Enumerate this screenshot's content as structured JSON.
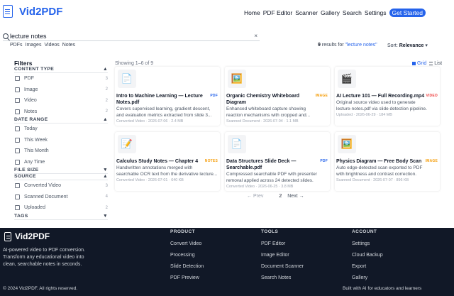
{
  "header": {
    "brand": "Vid2PDF",
    "nav": [
      "Home",
      "PDF Editor",
      "Scanner",
      "Gallery",
      "Search",
      "Settings"
    ],
    "cta": "Get Started",
    "colors": {
      "accent": "#2563eb"
    }
  },
  "search": {
    "value": "lecture notes",
    "clear_symbol": "×",
    "tabs": [
      "PDFs",
      "Images",
      "Videos",
      "Notes"
    ],
    "results_count": "9",
    "results_text": "results for",
    "query_display": "\"lecture notes\"",
    "sort_label": "Sort:",
    "sort_value": "Relevance",
    "sort_caret": "▾"
  },
  "sidebar": {
    "title": "Filters",
    "sections": [
      {
        "name": "CONTENT TYPE",
        "caret": "▲",
        "options": [
          {
            "label": "PDF",
            "count": "3"
          },
          {
            "label": "Image",
            "count": "2"
          },
          {
            "label": "Video",
            "count": "2"
          },
          {
            "label": "Notes",
            "count": "2"
          }
        ]
      },
      {
        "name": "DATE RANGE",
        "caret": "▲",
        "options": [
          {
            "label": "Today"
          },
          {
            "label": "This Week"
          },
          {
            "label": "This Month"
          },
          {
            "label": "Any Time"
          }
        ]
      },
      {
        "name": "FILE SIZE",
        "caret": "▼",
        "options": []
      },
      {
        "name": "SOURCE",
        "caret": "▲",
        "options": [
          {
            "label": "Converted Video",
            "count": "3"
          },
          {
            "label": "Scanned Document",
            "count": "4"
          },
          {
            "label": "Uploaded",
            "count": "2"
          }
        ]
      },
      {
        "name": "TAGS",
        "caret": "▼",
        "options": []
      }
    ]
  },
  "main": {
    "showing": "Showing 1–6 of 9",
    "view_grid": "Grid",
    "view_list": "List",
    "cards": [
      {
        "icon": "📄",
        "icon_name": "document-icon",
        "badge": "PDF",
        "badge_color": "#2563eb",
        "title_lines": [
          "Intro to Machine Learning — Lecture",
          "Notes.pdf"
        ],
        "desc_lines": [
          "Covers supervised learning, gradient descent,",
          "and evaluation metrics extracted from slide 3..."
        ],
        "meta": "Converted Video  ·  2026-07-06  ·  2.4 MB"
      },
      {
        "icon": "🖼️",
        "icon_name": "image-icon",
        "badge": "IMAGE",
        "badge_color": "#f59e0b",
        "title_lines": [
          "Organic Chemistry Whiteboard",
          "Diagram"
        ],
        "desc_lines": [
          "Enhanced whiteboard capture showing",
          "reaction mechanisms with cropped and..."
        ],
        "meta": "Scanned Document  ·  2026-07-04  ·  1.1 MB"
      },
      {
        "icon": "🎬",
        "icon_name": "clapperboard-icon",
        "badge": "VIDEO",
        "badge_color": "#ef4444",
        "title_lines": [
          "AI Lecture 101 — Full Recording.mp4"
        ],
        "desc_lines": [
          "Original source video used to generate",
          "lecture-notes.pdf via slide detection pipeline."
        ],
        "meta": "Uploaded  ·  2026-06-29  ·  184 MB"
      },
      {
        "icon": "📝",
        "icon_name": "memo-icon",
        "badge": "NOTES",
        "badge_color": "#f59e0b",
        "title_lines": [
          "Calculus Study Notes — Chapter 4"
        ],
        "desc_lines": [
          "Handwritten annotations merged with",
          "searchable OCR text from the derivative lecture..."
        ],
        "meta": "Converted Video  ·  2026-07-01  ·  640 KB"
      },
      {
        "icon": "📄",
        "icon_name": "document-icon",
        "badge": "PDF",
        "badge_color": "#2563eb",
        "title_lines": [
          "Data Structures Slide Deck —",
          "Searchable.pdf"
        ],
        "desc_lines": [
          "Compressed searchable PDF with presenter",
          "removal applied across 24 detected slides."
        ],
        "meta": "Converted Video  ·  2026-06-25  ·  3.8 MB"
      },
      {
        "icon": "🖼️",
        "icon_name": "image-icon",
        "badge": "IMAGE",
        "badge_color": "#f59e0b",
        "title_lines": [
          "Physics Diagram — Free Body Scan"
        ],
        "desc_lines": [
          "Auto edge-detected scan exported to PDF",
          "with brightness and contrast correction."
        ],
        "meta": "Scanned Document  ·  2026-07-07  ·  896 KB"
      }
    ],
    "pager": {
      "prev": "← Prev",
      "current": "2",
      "next": "Next →"
    }
  },
  "footer": {
    "brand": "Vid2PDF",
    "desc_lines": [
      "AI-powered video to PDF conversion.",
      "Transform any educational video into",
      "clean, searchable notes in seconds."
    ],
    "columns": [
      {
        "head": "PRODUCT",
        "links": [
          "Convert Video",
          "Processing",
          "Slide Detection",
          "PDF Preview"
        ]
      },
      {
        "head": "TOOLS",
        "links": [
          "PDF Editor",
          "Image Editor",
          "Document Scanner",
          "Search Notes"
        ]
      },
      {
        "head": "ACCOUNT",
        "links": [
          "Settings",
          "Cloud Backup",
          "Export",
          "Gallery"
        ]
      }
    ],
    "copyright": "© 2024 Vid2PDF. All rights reserved.",
    "tagline": "Built with AI for educators and learners"
  }
}
